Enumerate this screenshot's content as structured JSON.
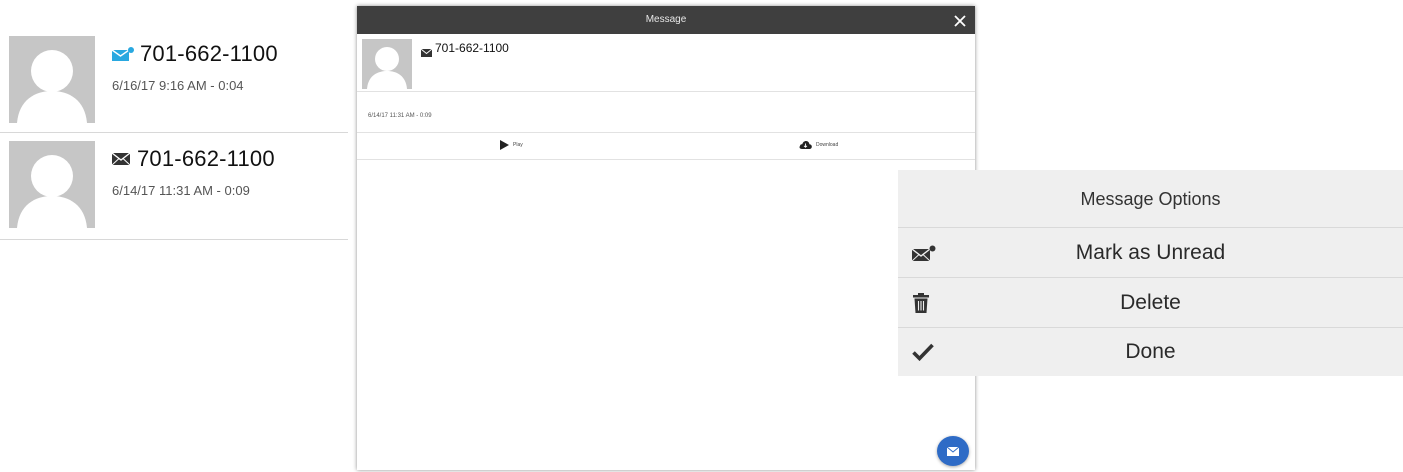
{
  "list": {
    "items": [
      {
        "phone": "701-662-1100",
        "meta": "6/16/17 9:16 AM - 0:04",
        "unread": true
      },
      {
        "phone": "701-662-1100",
        "meta": "6/14/17 11:31 AM - 0:09",
        "unread": false
      }
    ]
  },
  "modal": {
    "title": "Message",
    "phone": "701-662-1100",
    "date": "6/14/17 11:31 AM - 0:09",
    "play_label": "Play",
    "download_label": "Download"
  },
  "options": {
    "title": "Message Options",
    "items": [
      {
        "label": "Mark as Unread",
        "icon": "envelope-unread-icon"
      },
      {
        "label": "Delete",
        "icon": "trash-icon"
      },
      {
        "label": "Done",
        "icon": "checkmark-icon"
      }
    ]
  },
  "colors": {
    "unread_accent": "#29a8e0",
    "header_bg": "#3f3f3f",
    "fab_bg": "#2e6bc6",
    "avatar_bg": "#c6c6c6",
    "sheet_bg": "#efefef"
  }
}
